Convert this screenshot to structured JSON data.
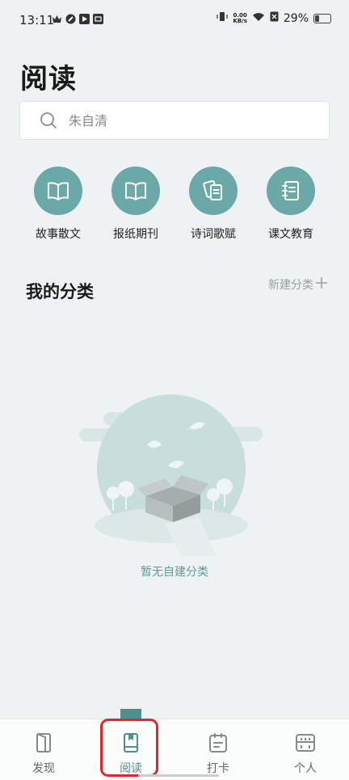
{
  "status_bar": {
    "time": "13:11",
    "netspeed_value": "0.00",
    "netspeed_unit": "KB/s",
    "battery": "29%"
  },
  "header": {
    "title": "阅读"
  },
  "search": {
    "placeholder": "朱自清"
  },
  "categories": [
    {
      "label": "故事散文",
      "icon": "open-book-icon"
    },
    {
      "label": "报纸期刊",
      "icon": "open-book-icon"
    },
    {
      "label": "诗词歌赋",
      "icon": "scroll-icon"
    },
    {
      "label": "课文教育",
      "icon": "notebook-icon"
    }
  ],
  "my_categories": {
    "title": "我的分类",
    "new_label": "新建分类",
    "empty_text": "暂无自建分类"
  },
  "bottom_nav": [
    {
      "label": "发现",
      "icon": "door-icon",
      "active": false
    },
    {
      "label": "阅读",
      "icon": "book-icon",
      "active": true
    },
    {
      "label": "打卡",
      "icon": "calendar-icon",
      "active": false
    },
    {
      "label": "个人",
      "icon": "profile-icon",
      "active": false
    }
  ],
  "colors": {
    "accent": "#6aa9a8",
    "background": "#eef2f2",
    "highlight": "#e3262b"
  }
}
